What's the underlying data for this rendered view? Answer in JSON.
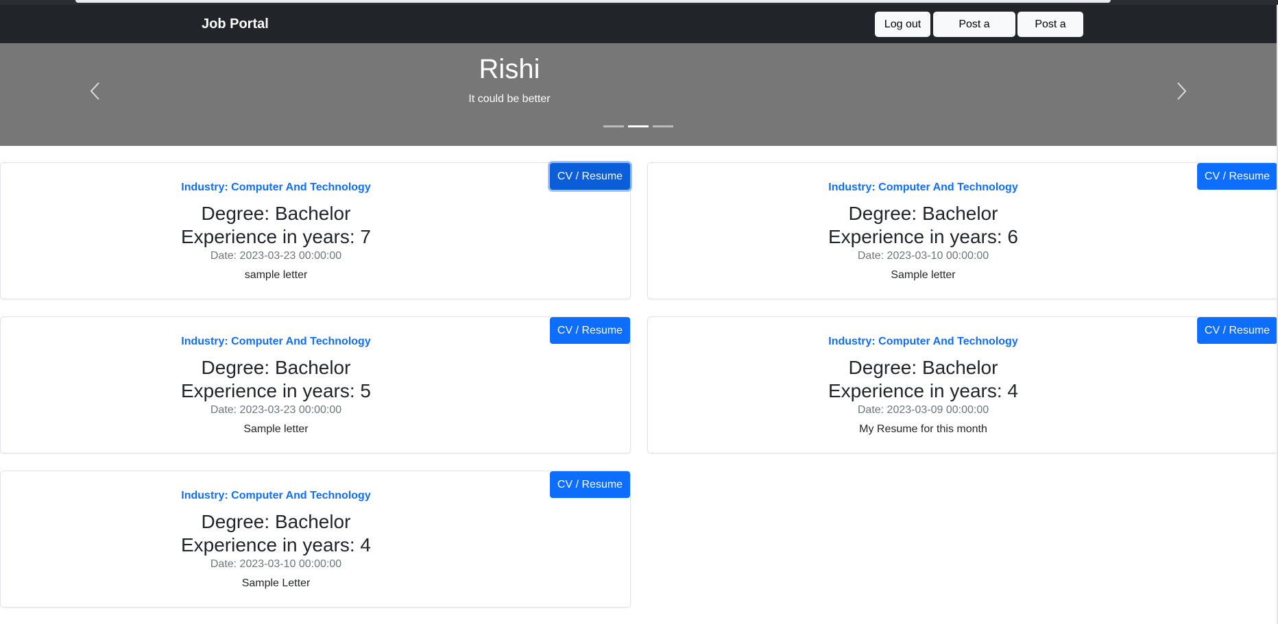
{
  "navbar": {
    "brand": "Job Portal",
    "buttons": [
      "Log out",
      "Post a review",
      "Post a job"
    ]
  },
  "carousel": {
    "title": "Rishi",
    "caption": "It could be better",
    "prev_icon": "chevron-left-icon",
    "next_icon": "chevron-right-icon",
    "slide_count": 3,
    "active_index": 1
  },
  "cards": [
    {
      "button": "CV / Resume",
      "industry": "Industry: Computer And Technology",
      "degree": "Degree: Bachelor",
      "experience": "Experience in years: 7",
      "date": "Date: 2023-03-23 00:00:00",
      "letter": "sample letter"
    },
    {
      "button": "CV / Resume",
      "industry": "Industry: Computer And Technology",
      "degree": "Degree: Bachelor",
      "experience": "Experience in years: 6",
      "date": "Date: 2023-03-10 00:00:00",
      "letter": "Sample letter"
    },
    {
      "button": "CV / Resume",
      "industry": "Industry: Computer And Technology",
      "degree": "Degree: Bachelor",
      "experience": "Experience in years: 5",
      "date": "Date: 2023-03-23 00:00:00",
      "letter": "Sample letter"
    },
    {
      "button": "CV / Resume",
      "industry": "Industry: Computer And Technology",
      "degree": "Degree: Bachelor",
      "experience": "Experience in years: 4",
      "date": "Date: 2023-03-09 00:00:00",
      "letter": "My Resume for this month"
    },
    {
      "button": "CV / Resume",
      "industry": "Industry: Computer And Technology",
      "degree": "Degree: Bachelor",
      "experience": "Experience in years: 4",
      "date": "Date: 2023-03-10 00:00:00",
      "letter": "Sample Letter"
    }
  ],
  "colors": {
    "navbar": "#212529",
    "carousel": "#777777",
    "primary": "#0d6efd"
  }
}
